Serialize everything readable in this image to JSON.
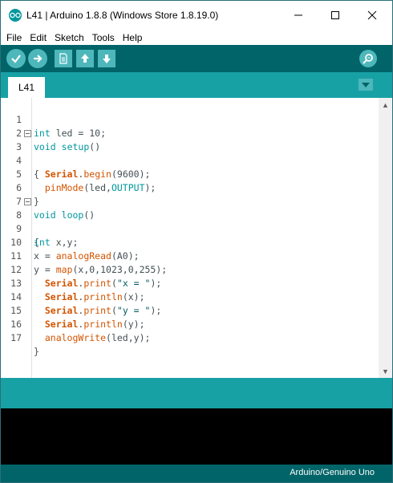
{
  "window": {
    "title": "L41 | Arduino 1.8.8 (Windows Store 1.8.19.0)",
    "controls": [
      "minimize-icon",
      "maximize-icon",
      "close-icon"
    ]
  },
  "menu": {
    "items": [
      "File",
      "Edit",
      "Sketch",
      "Tools",
      "Help"
    ]
  },
  "toolbar": {
    "buttons": [
      "verify-icon",
      "upload-icon",
      "new-icon",
      "open-icon",
      "save-icon",
      "serial-monitor-icon"
    ]
  },
  "tabs": [
    {
      "label": "L41",
      "active": true
    }
  ],
  "editor": {
    "line_numbers": [
      "1",
      "2",
      "3",
      "4",
      "5",
      "6",
      "7",
      "8",
      "9",
      "10",
      "11",
      "12",
      "13",
      "14",
      "15",
      "16",
      "17"
    ],
    "lines": [
      "int led = 10;",
      "void setup()",
      "{",
      "  Serial.begin(9600);",
      "  pinMode(led,OUTPUT);",
      "}",
      "void loop()",
      "{",
      "int x,y;",
      "x = analogRead(A0);",
      "y = map(x,0,1023,0,255);",
      "  Serial.print(\"x = \");",
      "  Serial.println(x);",
      "  Serial.print(\"y = \");",
      "  Serial.println(y);",
      "  analogWrite(led,y);",
      "}"
    ]
  },
  "status": {
    "board": "Arduino/Genuino Uno"
  },
  "colors": {
    "toolbar": "#006468",
    "tabbar": "#17a1a5",
    "button": "#4db7bb",
    "keyword": "#00979c",
    "function": "#d35400"
  }
}
